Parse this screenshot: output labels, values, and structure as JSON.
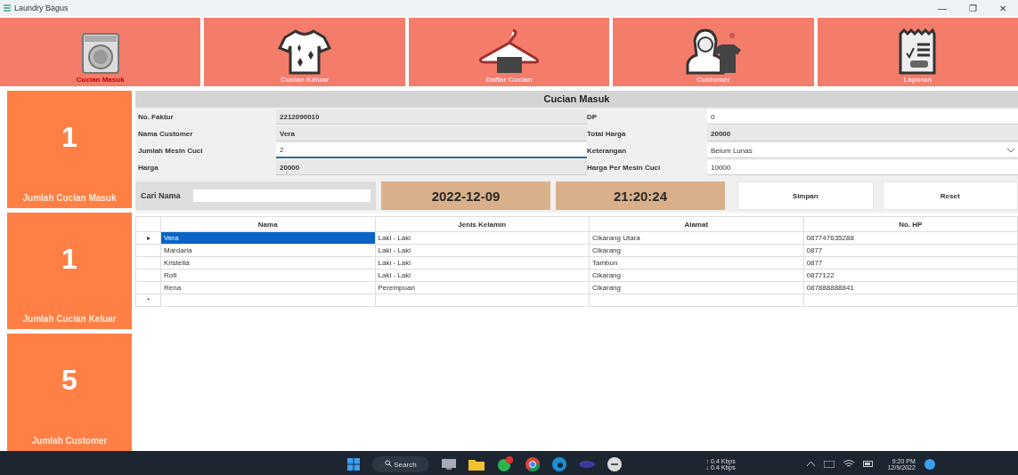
{
  "window": {
    "title": "Laundry Bagus",
    "controls": [
      "—",
      "❐",
      "✕"
    ]
  },
  "nav": [
    {
      "label": "Cucian Masuk",
      "selected": true
    },
    {
      "label": "Cucian Keluar",
      "selected": false
    },
    {
      "label": "Daftar Cucian",
      "selected": false
    },
    {
      "label": "Customer",
      "selected": false
    },
    {
      "label": "Laporan",
      "selected": false
    }
  ],
  "stats": [
    {
      "value": "1",
      "label": "Jumlah Cucian Masuk"
    },
    {
      "value": "1",
      "label": "Jumlah Cucian Keluar"
    },
    {
      "value": "5",
      "label": "Jumlah Customer"
    }
  ],
  "form": {
    "title": "Cucian Masuk",
    "left": [
      {
        "label": "No. Faktur",
        "value": "2212090010",
        "kind": "readonly",
        "focused": false
      },
      {
        "label": "Nama Customer",
        "value": "Vera",
        "kind": "readonly",
        "focused": false
      },
      {
        "label": "Jumlah Mesin Cuci",
        "value": "2",
        "kind": "input",
        "focused": true
      },
      {
        "label": "Harga",
        "value": "20000",
        "kind": "readonly",
        "focused": false
      }
    ],
    "right": [
      {
        "label": "DP",
        "value": "0",
        "kind": "input",
        "focused": false
      },
      {
        "label": "Total Harga",
        "value": "20000",
        "kind": "readonly",
        "focused": false
      },
      {
        "label": "Keterangan",
        "value": "Belum Lunas",
        "kind": "dropdown",
        "focused": false
      },
      {
        "label": "Harga Per Mesin Cuci",
        "value": "10000",
        "kind": "input",
        "focused": false
      }
    ]
  },
  "search": {
    "label": "Cari Nama"
  },
  "date": "2022-12-09",
  "time": "21:20:24",
  "buttons": [
    "Simpan",
    "Reset"
  ],
  "table": {
    "columns": [
      "Nama",
      "Jenis Kelamin",
      "Alamat",
      "No. HP"
    ],
    "rows": [
      {
        "marker": "▸",
        "selected": true,
        "cells": [
          "Vera",
          "Laki - Laki",
          "Cikarang Utara",
          "087747635288"
        ]
      },
      {
        "marker": "",
        "selected": false,
        "cells": [
          "Mardaria",
          "Laki - Laki",
          "Cikarang",
          "0877"
        ]
      },
      {
        "marker": "",
        "selected": false,
        "cells": [
          "Kristella",
          "Laki - Laki",
          "Tambun",
          "0877"
        ]
      },
      {
        "marker": "",
        "selected": false,
        "cells": [
          "Rofi",
          "Laki - Laki",
          "Cikarang",
          "0877122"
        ]
      },
      {
        "marker": "",
        "selected": false,
        "cells": [
          "Rena",
          "Perempuan",
          "Cikarang",
          "087888888841"
        ]
      },
      {
        "marker": "*",
        "selected": false,
        "cells": []
      }
    ]
  },
  "taskbar": {
    "search": "Search",
    "network": [
      "↑ 0.4 Kbps",
      "↓ 0.4 Kbps"
    ],
    "time": "9:20 PM",
    "date": "12/9/2022"
  }
}
